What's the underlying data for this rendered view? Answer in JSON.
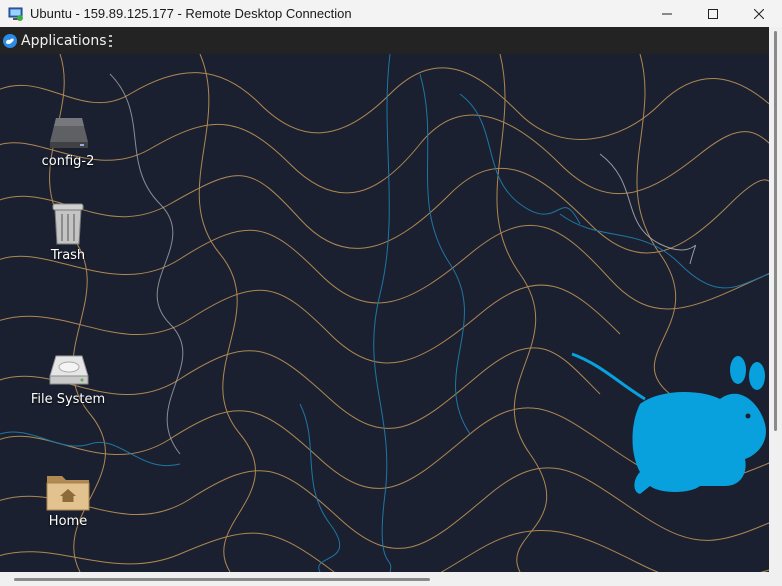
{
  "window": {
    "title": "Ubuntu - 159.89.125.177 - Remote Desktop Connection",
    "app_icon": "remote-desktop-icon",
    "controls": [
      "minimize-icon",
      "maximize-icon",
      "close-icon"
    ]
  },
  "panel": {
    "menu_label": "Applications",
    "menu_icon": "xfce-logo-icon"
  },
  "desktop": {
    "wallpaper": "xfce-topographic-mouse",
    "icons": [
      {
        "label": "config-2",
        "icon": "drive-icon"
      },
      {
        "label": "Trash",
        "icon": "trash-icon"
      },
      {
        "label": "File System",
        "icon": "harddisk-icon"
      },
      {
        "label": "Home",
        "icon": "home-folder-icon"
      }
    ]
  },
  "colors": {
    "titlebar_bg": "#f3f3f3",
    "panel_bg": "#232324",
    "desktop_bg": "#1b2030",
    "contour_orange": "#c89a58",
    "contour_blue": "#1f86b8",
    "mouse_blue": "#09a0de"
  }
}
